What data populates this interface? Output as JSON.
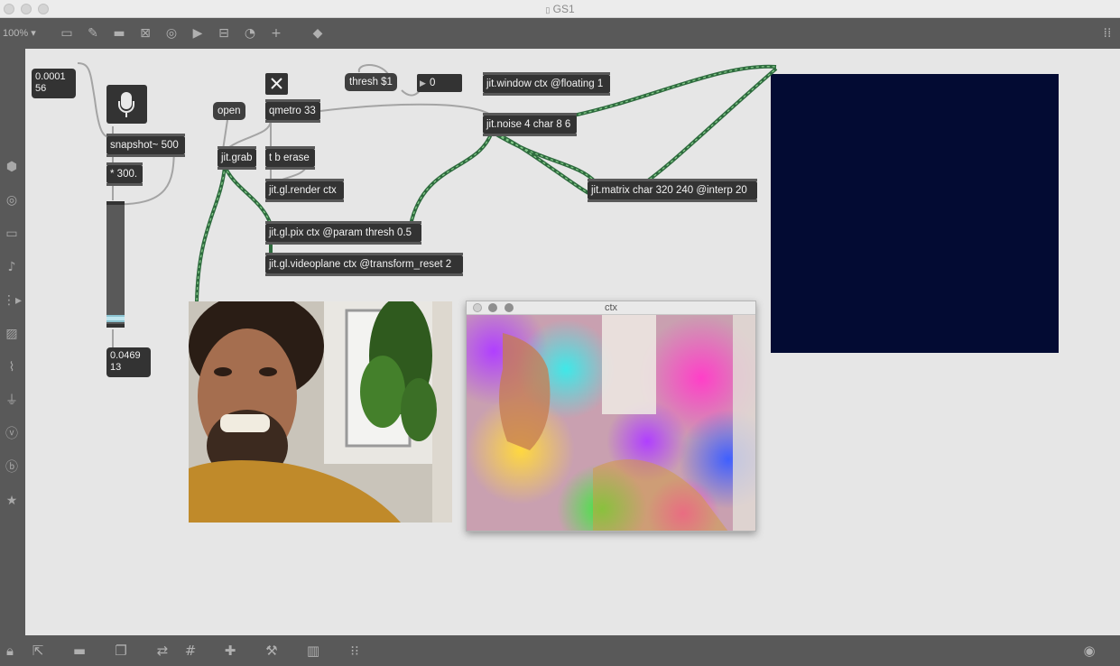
{
  "window": {
    "title": "GS1",
    "zoom": "100%"
  },
  "toolbar": {
    "icons": [
      "presentation-icon",
      "edit-icon",
      "comment-icon",
      "close-box-icon",
      "bang-icon",
      "play-icon",
      "slider-icon",
      "dial-icon",
      "plus-icon",
      "paint-bucket-icon",
      "grid-dots-icon"
    ]
  },
  "sidebar": {
    "icons": [
      "cube-icon",
      "target-icon",
      "slider-icon",
      "music-note-icon",
      "step-icon",
      "image-icon",
      "paperclip-icon",
      "plug-icon",
      "vizzie-icon",
      "beap-icon",
      "star-icon"
    ]
  },
  "bottombar": {
    "icons": [
      "lock-icon",
      "pointer-icon",
      "presentation-icon",
      "windows-icon",
      "inspector-icon",
      "grid-icon",
      "add-icon",
      "wrench-icon",
      "keyboard-icon",
      "midi-icon",
      "play-circle-icon"
    ]
  },
  "objects": {
    "snapshot": "snapshot~ 500",
    "multiply": "* 300.",
    "jit_grab": "jit.grab",
    "qmetro": "qmetro 33",
    "trigger": "t b erase",
    "render": "jit.gl.render ctx",
    "pix": "jit.gl.pix ctx @param thresh 0.5",
    "videoplane": "jit.gl.videoplane ctx @transform_reset 2",
    "window": "jit.window ctx @floating 1",
    "noise": "jit.noise 4 char 8 6",
    "matrix": "jit.matrix char 320 240 @interp 20"
  },
  "messages": {
    "open": "open",
    "thresh": "thresh $1"
  },
  "numbers": {
    "top_left": "0.0001\n56",
    "int_box": "0",
    "bottom_left": "0.0469\n13"
  },
  "ctx_window": {
    "title": "ctx"
  },
  "colors": {
    "canvas": "#e6e6e6",
    "object": "#333333",
    "cable_matrix": "#2f8a4f",
    "jit_pwindow": "#030b33"
  }
}
